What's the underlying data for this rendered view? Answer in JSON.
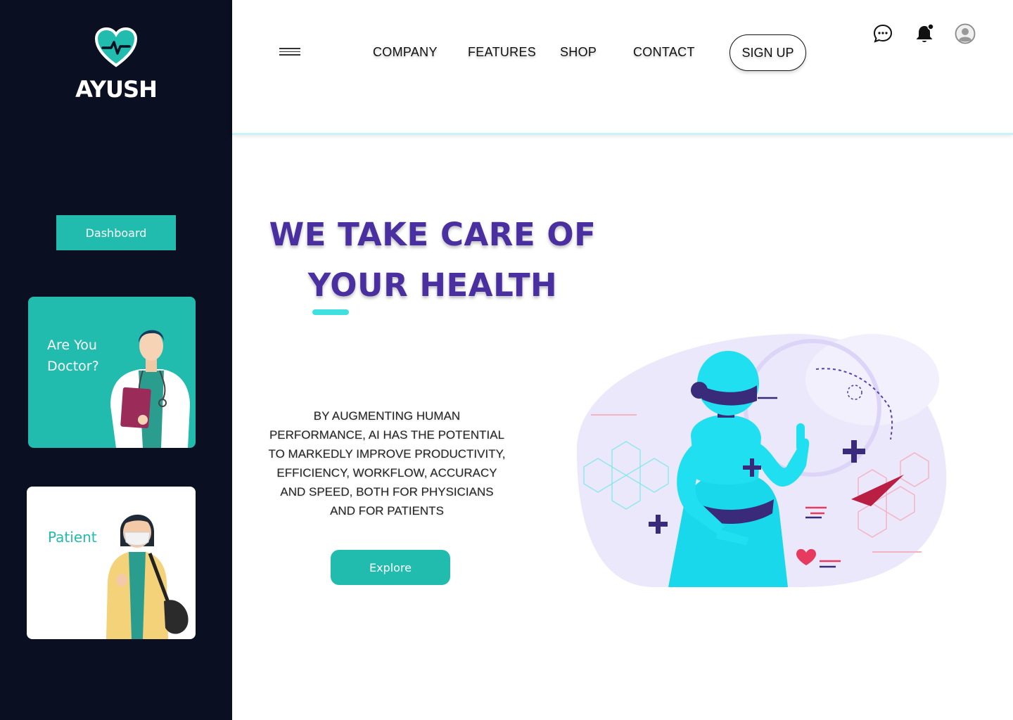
{
  "sidebar": {
    "brand": "AYUSH",
    "logo_icon": "heart-pulse-icon",
    "dashboard_label": "Dashboard",
    "cards": {
      "doctor": "Are You Doctor?",
      "patient": "Patient"
    }
  },
  "header": {
    "nav": {
      "company": "COMPANY",
      "features": "FEATURES",
      "shop": "SHOP",
      "contact": "CONTACT"
    },
    "signup_label": "SIGN UP",
    "icons": [
      "menu-icon",
      "chat-icon",
      "bell-icon",
      "user-icon"
    ]
  },
  "hero": {
    "title": "WE TAKE CARE OF YOUR HEALTH",
    "description": "BY AUGMENTING HUMAN PERFORMANCE, AI HAS THE POTENTIAL TO MARKEDLY IMPROVE PRODUCTIVITY, EFFICIENCY, WORKFLOW, ACCURACY AND SPEED, BOTH FOR PHYSICIANS AND FOR PATIENTS",
    "explore_label": "Explore"
  },
  "colors": {
    "sidebar_bg": "#0a0f21",
    "accent": "#21bcad",
    "title": "#4a2fa0",
    "cyan": "#3ee0e0"
  }
}
